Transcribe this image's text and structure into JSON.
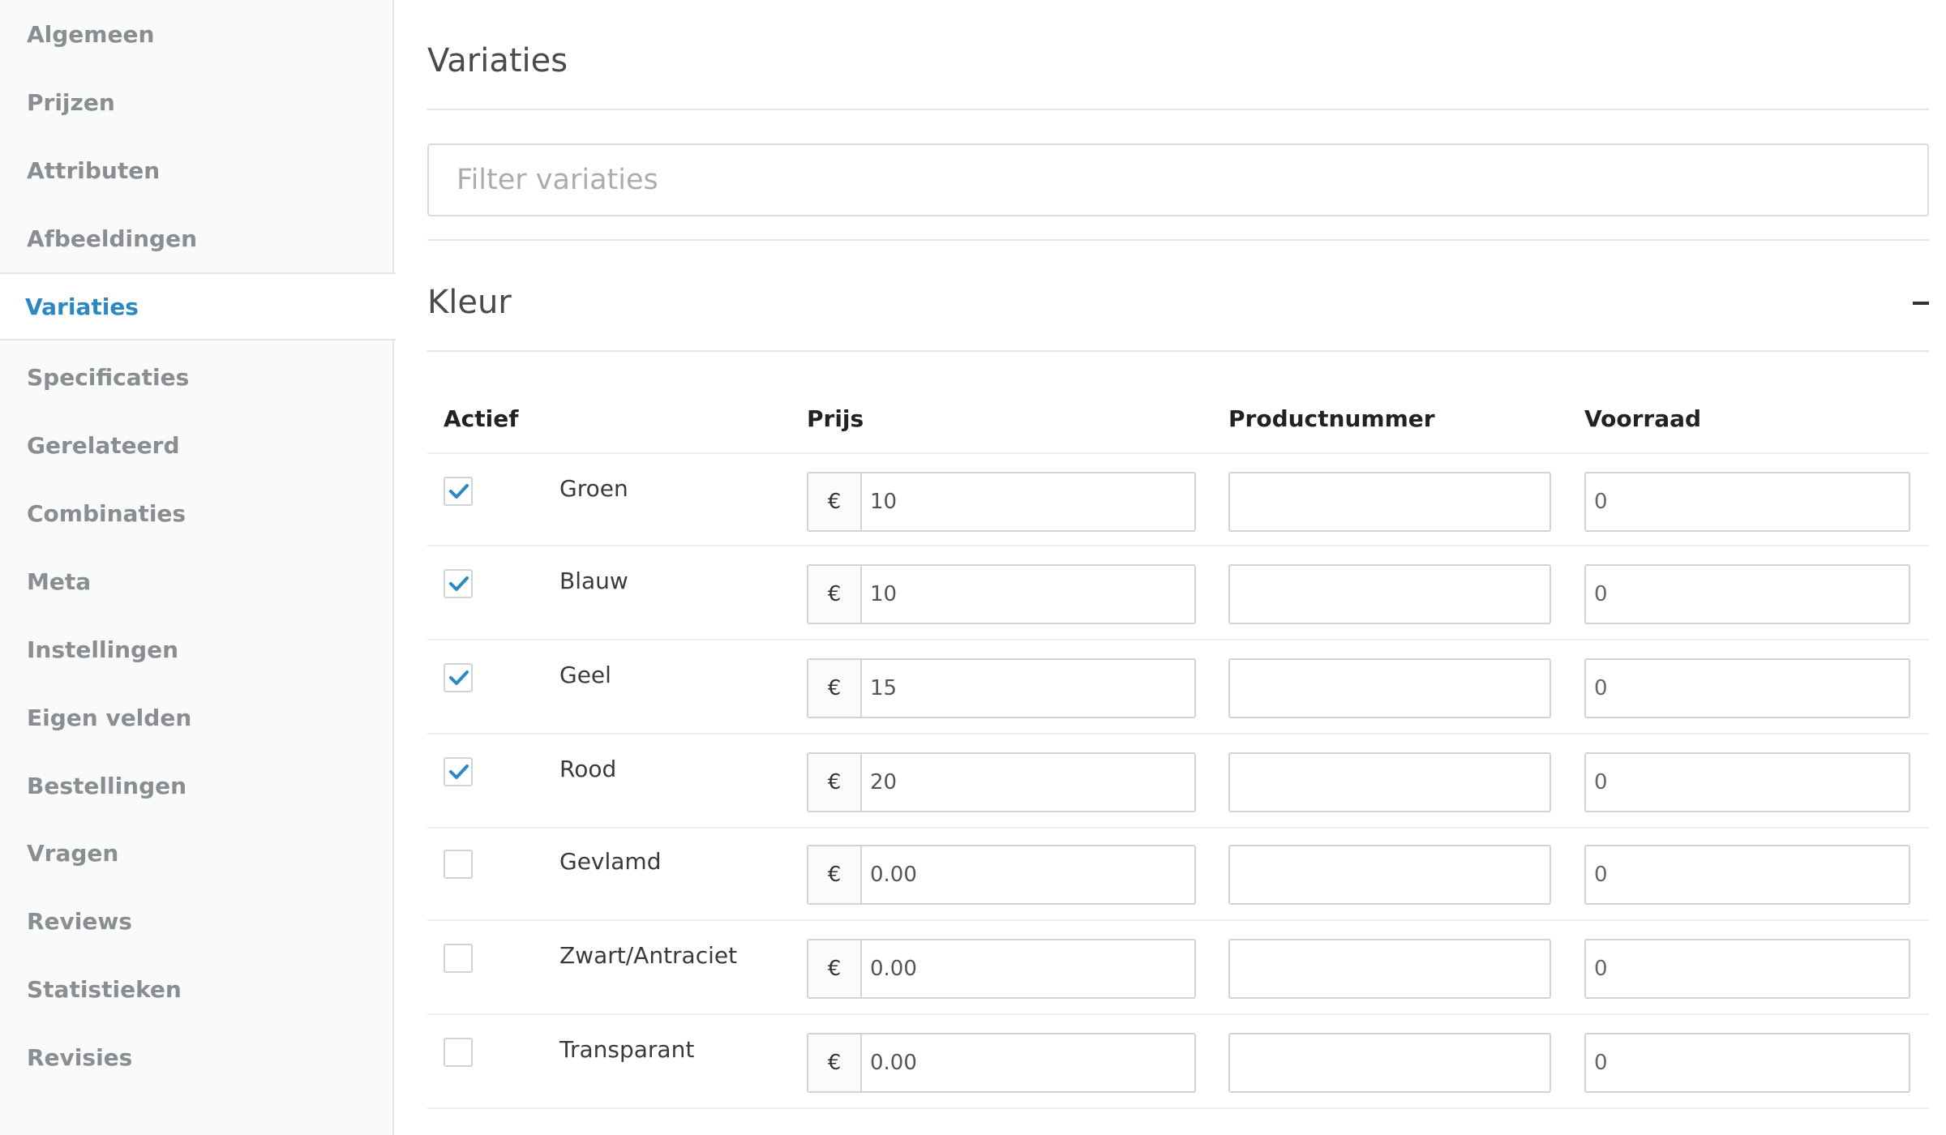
{
  "sidebar": {
    "items": [
      {
        "label": "Algemeen",
        "active": false
      },
      {
        "label": "Prijzen",
        "active": false
      },
      {
        "label": "Attributen",
        "active": false
      },
      {
        "label": "Afbeeldingen",
        "active": false
      },
      {
        "label": "Variaties",
        "active": true
      },
      {
        "label": "Specificaties",
        "active": false
      },
      {
        "label": "Gerelateerd",
        "active": false
      },
      {
        "label": "Combinaties",
        "active": false
      },
      {
        "label": "Meta",
        "active": false
      },
      {
        "label": "Instellingen",
        "active": false
      },
      {
        "label": "Eigen velden",
        "active": false
      },
      {
        "label": "Bestellingen",
        "active": false
      },
      {
        "label": "Vragen",
        "active": false
      },
      {
        "label": "Reviews",
        "active": false
      },
      {
        "label": "Statistieken",
        "active": false
      },
      {
        "label": "Revisies",
        "active": false
      }
    ]
  },
  "main": {
    "title": "Variaties",
    "filter_placeholder": "Filter variaties",
    "section": {
      "title": "Kleur",
      "collapse_icon": "minus-icon"
    },
    "table": {
      "columns": {
        "active": "Actief",
        "price": "Prijs",
        "sku": "Productnummer",
        "stock": "Voorraad"
      },
      "currency_symbol": "€",
      "rows": [
        {
          "label": "Groen",
          "checked": true,
          "price": "10",
          "sku": "",
          "stock": "0"
        },
        {
          "label": "Blauw",
          "checked": true,
          "price": "10",
          "sku": "",
          "stock": "0"
        },
        {
          "label": "Geel",
          "checked": true,
          "price": "15",
          "sku": "",
          "stock": "0"
        },
        {
          "label": "Rood",
          "checked": true,
          "price": "20",
          "sku": "",
          "stock": "0"
        },
        {
          "label": "Gevlamd",
          "checked": false,
          "price": "0.00",
          "sku": "",
          "stock": "0"
        },
        {
          "label": "Zwart/Antraciet",
          "checked": false,
          "price": "0.00",
          "sku": "",
          "stock": "0"
        },
        {
          "label": "Transparant",
          "checked": false,
          "price": "0.00",
          "sku": "",
          "stock": "0"
        }
      ]
    }
  },
  "colors": {
    "accent": "#2c87c5",
    "sidebar_bg": "#f9fafa",
    "border": "#cfd4d8",
    "check": "#2c87c5"
  }
}
